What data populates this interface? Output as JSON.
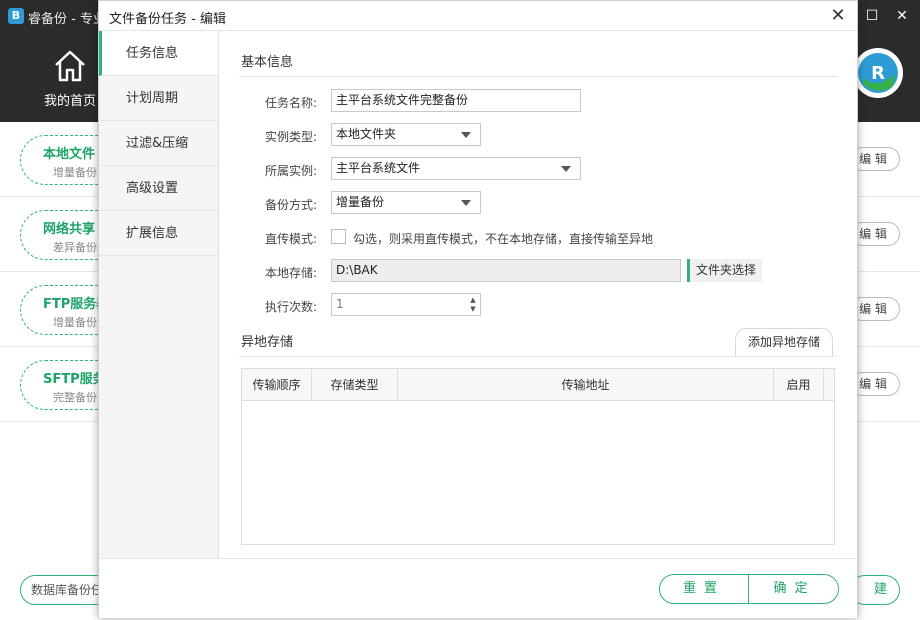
{
  "main_window": {
    "title": "睿备份 - 专业",
    "home_label": "我的首页",
    "edit_label": "编 辑",
    "tasks": [
      {
        "name": "本地文件",
        "sub": "增量备份"
      },
      {
        "name": "网络共享",
        "sub": "差异备份"
      },
      {
        "name": "FTP服务器",
        "sub": "增量备份"
      },
      {
        "name": "SFTP服务",
        "sub": "完整备份"
      }
    ],
    "db_backup_label": "数据库备份任务",
    "new_label": "建"
  },
  "dialog": {
    "title": "文件备份任务 - 编辑",
    "close_label": "✕",
    "nav": [
      {
        "label": "任务信息",
        "active": true
      },
      {
        "label": "计划周期",
        "active": false
      },
      {
        "label": "过滤&压缩",
        "active": false
      },
      {
        "label": "高级设置",
        "active": false
      },
      {
        "label": "扩展信息",
        "active": false
      }
    ],
    "basic_section": "基本信息",
    "form": {
      "task_name_label": "任务名称:",
      "task_name_value": "主平台系统文件完整备份",
      "instance_type_label": "实例类型:",
      "instance_type_value": "本地文件夹",
      "instance_label": "所属实例:",
      "instance_value": "主平台系统文件",
      "backup_mode_label": "备份方式:",
      "backup_mode_value": "增量备份",
      "direct_upload_label": "直传模式:",
      "direct_upload_text": "勾选，则采用直传模式，不在本地存储，直接传输至异地",
      "direct_upload_checked": false,
      "local_storage_label": "本地存储:",
      "local_storage_value": "D:\\BAK",
      "folder_select_label": "文件夹选择",
      "run_count_label": "执行次数:",
      "run_count_value": "1"
    },
    "remote_section": "异地存储",
    "add_remote_label": "添加异地存储",
    "table_headers": [
      "传输顺序",
      "存储类型",
      "传输地址",
      "启用"
    ],
    "table_rows": [],
    "reset_label": "重置",
    "ok_label": "确定"
  },
  "colors": {
    "accent": "#2fb37b",
    "titlebar": "#2b2b2b"
  }
}
